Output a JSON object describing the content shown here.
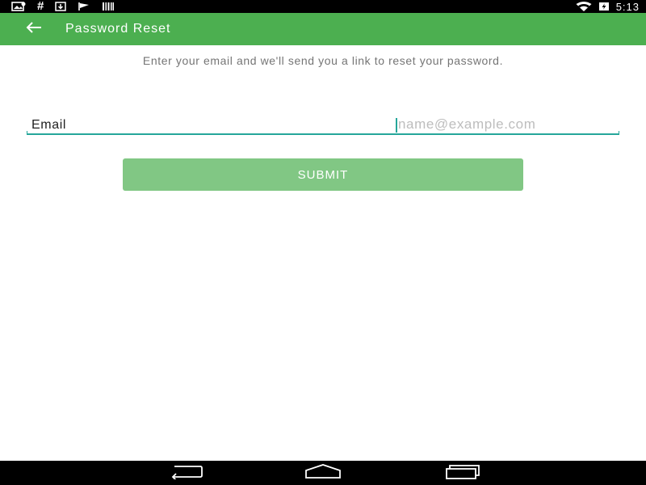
{
  "status_bar": {
    "time": "5:13",
    "icons": [
      "photo-map-icon",
      "hash-icon",
      "download-icon",
      "flag-icon",
      "barcode-icon",
      "wifi-icon",
      "battery-charging-icon"
    ],
    "hash_glyph": "#"
  },
  "toolbar": {
    "title": "Password Reset",
    "back_icon": "arrow-back-icon",
    "background": "#4caf50"
  },
  "main": {
    "instructions": "Enter your email and we'll send you a link to reset your password.",
    "email_label": "Email",
    "email_value": "",
    "email_placeholder": "name@example.com",
    "submit_label": "SUBMIT",
    "accent": "#26a69a",
    "button_color": "#81c784"
  },
  "nav_bar": {
    "icons": [
      "back-icon",
      "home-icon",
      "recents-icon"
    ]
  }
}
